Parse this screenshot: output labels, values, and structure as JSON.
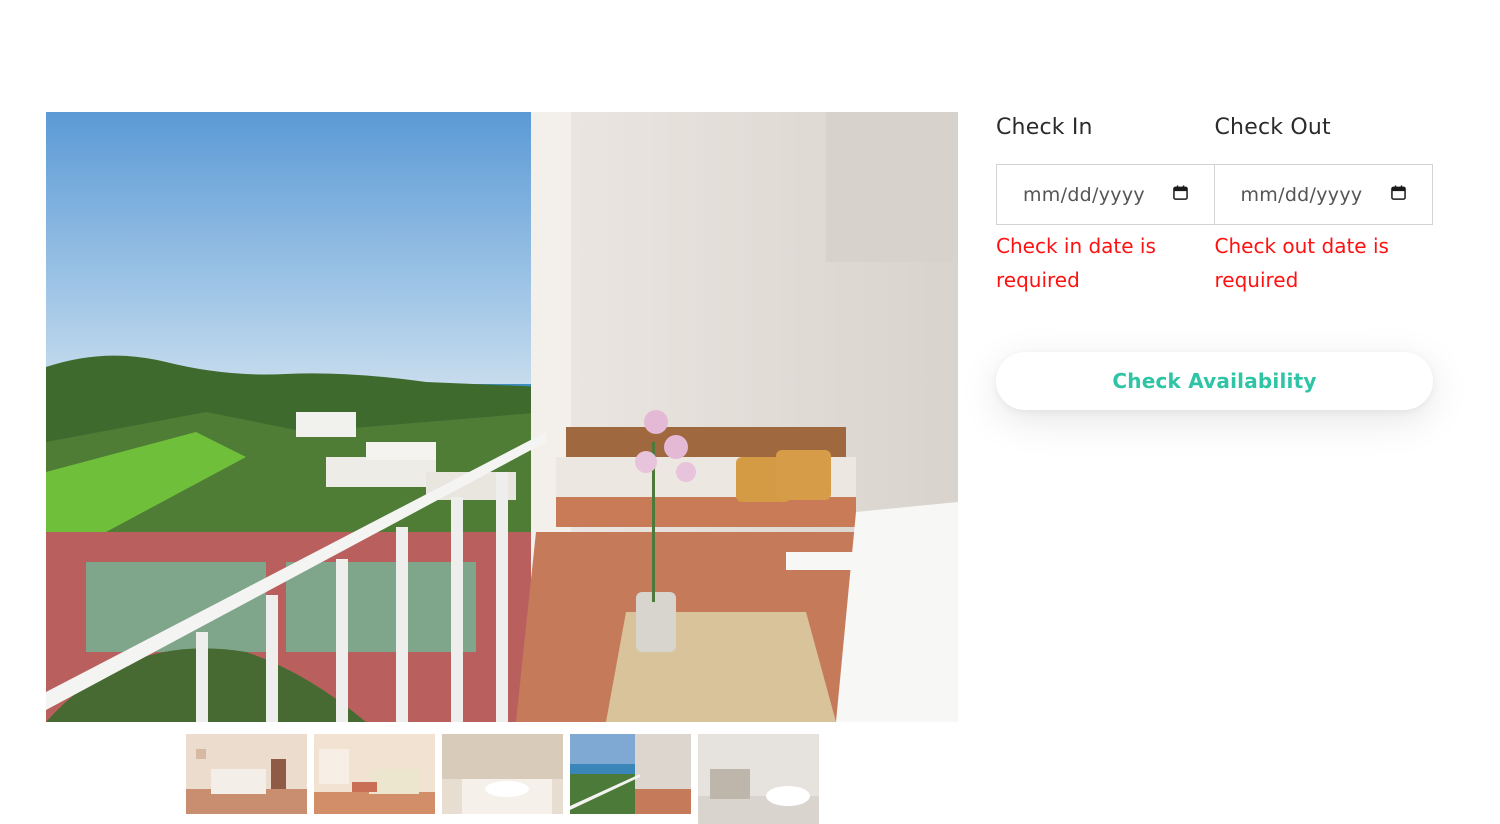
{
  "gallery": {
    "main_image": "hotel-balcony-sea-view-photo",
    "thumbnails": [
      {
        "image": "bedroom-photo"
      },
      {
        "image": "living-room-photo"
      },
      {
        "image": "bathroom-sink-photo"
      },
      {
        "image": "balcony-sea-view-photo"
      },
      {
        "image": "bathroom-bathtub-photo"
      }
    ]
  },
  "booking": {
    "check_in": {
      "label": "Check In",
      "placeholder": "mm/dd/yyyy",
      "error": "Check in date is required"
    },
    "check_out": {
      "label": "Check Out",
      "placeholder": "mm/dd/yyyy",
      "error": "Check out date is required"
    },
    "submit_label": "Check Availability"
  },
  "colors": {
    "accent": "#2ec4a5",
    "error": "#ff1111",
    "label": "#2b2b2b",
    "border": "#d3d3d3"
  },
  "icons": {
    "calendar": "calendar-icon"
  }
}
